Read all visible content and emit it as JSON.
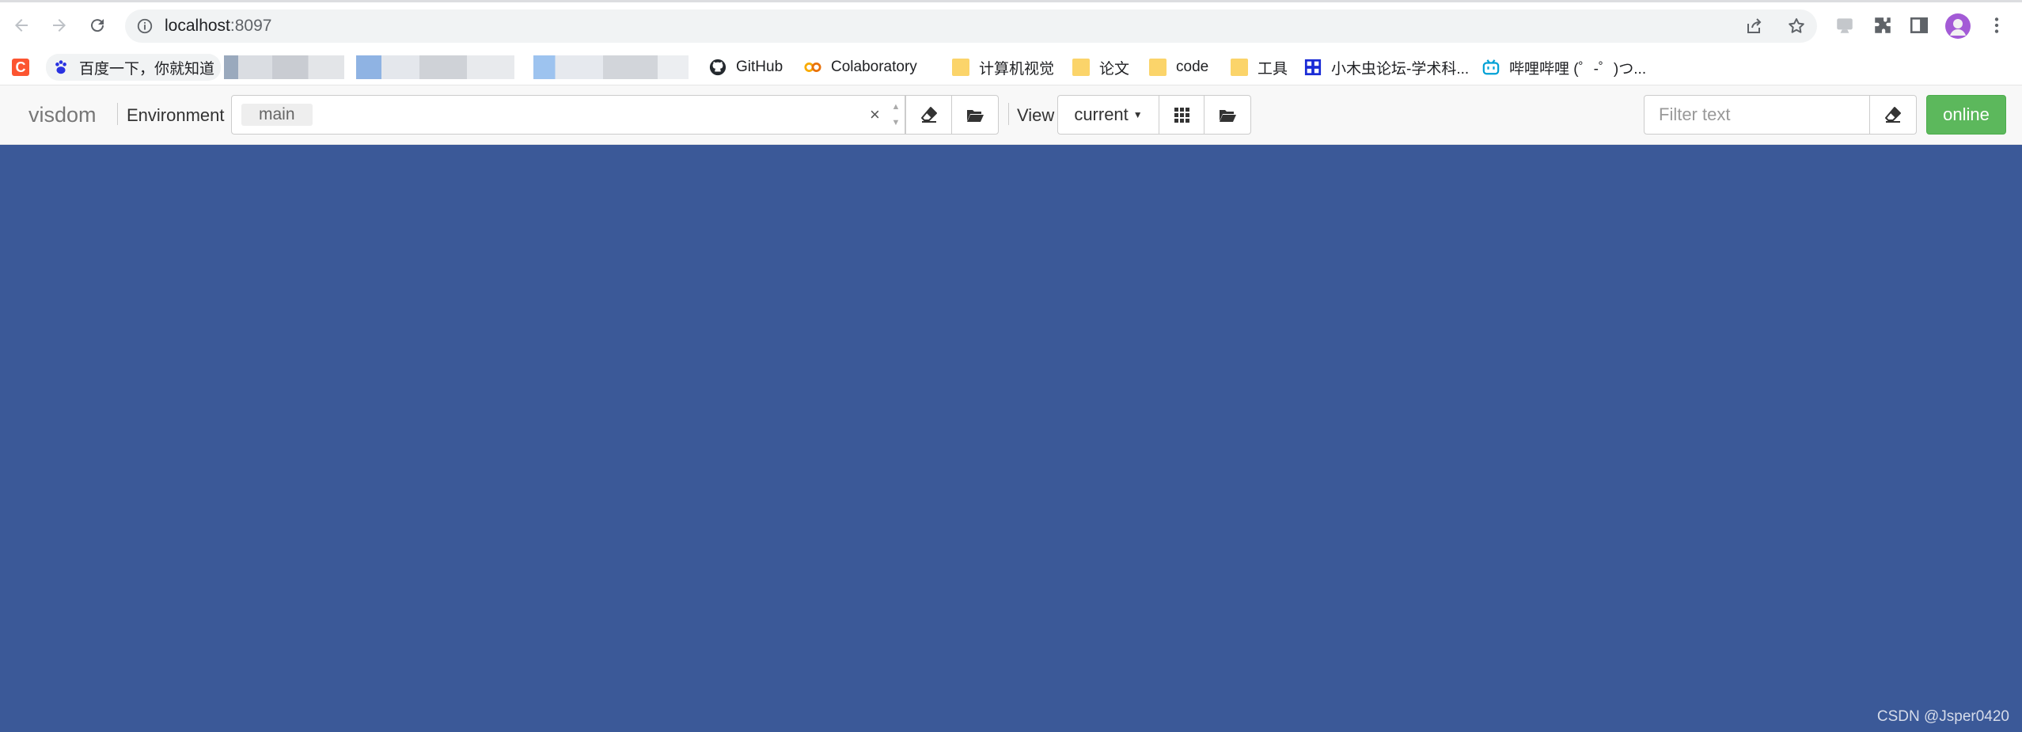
{
  "browser": {
    "url_host": "localhost",
    "url_port": ":8097"
  },
  "bookmarks": [
    {
      "label": "百度一下，你就知道",
      "icon": "baidu-paw-icon"
    },
    {
      "label": "GitHub",
      "icon": "github-icon"
    },
    {
      "label": "Colaboratory",
      "icon": "colab-icon"
    },
    {
      "label": "计算机视觉",
      "icon": "folder-icon"
    },
    {
      "label": "论文",
      "icon": "folder-icon"
    },
    {
      "label": "code",
      "icon": "folder-icon"
    },
    {
      "label": "工具",
      "icon": "folder-icon"
    },
    {
      "label": "小木虫论坛-学术科...",
      "icon": "muchong-icon"
    },
    {
      "label": "哔哩哔哩 (゜-゜)つ...",
      "icon": "bilibili-icon"
    }
  ],
  "visdom": {
    "brand": "visdom",
    "environment_label": "Environment",
    "selected_env": "main",
    "clear_symbol": "×",
    "view_label": "View",
    "view_value": "current",
    "filter_placeholder": "Filter text",
    "status_button": "online"
  },
  "colors": {
    "main_background": "#3b5998",
    "online_button": "#5cb85c"
  },
  "watermark": "CSDN @Jsper0420"
}
